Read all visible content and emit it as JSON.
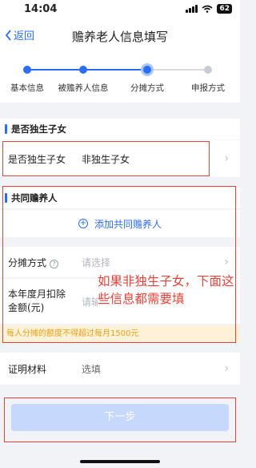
{
  "status_bar": {
    "time": "14:04",
    "battery": "62"
  },
  "nav": {
    "back_label": "返回",
    "title": "赡养老人信息填写"
  },
  "steps": [
    {
      "label": "基本信息",
      "state": "done"
    },
    {
      "label": "被赡养人信息",
      "state": "done"
    },
    {
      "label": "分摊方式",
      "state": "current"
    },
    {
      "label": "申报方式",
      "state": "pending"
    }
  ],
  "only_child_section": {
    "header": "是否独生子女",
    "row_label": "是否独生子女",
    "row_value": "非独生子女"
  },
  "co_supporter_section": {
    "header": "共同赡养人",
    "add_label": "添加共同赡养人"
  },
  "allocation": {
    "label": "分摊方式",
    "placeholder": "请选择"
  },
  "monthly_deduction": {
    "label_line1": "本年度月扣除",
    "label_line2": "金额(元)",
    "placeholder": "请输入"
  },
  "warning_text": "每人分摊的额度不得超过每月1500元",
  "proof": {
    "label": "证明材料",
    "placeholder": "选填"
  },
  "annotation_text": "如果非独生子女，下面这些信息都需要填",
  "submit_label": "下一步",
  "colors": {
    "accent": "#2b6ef2",
    "annotation": "#e8423b",
    "warning_bg": "#fdf2d7"
  }
}
